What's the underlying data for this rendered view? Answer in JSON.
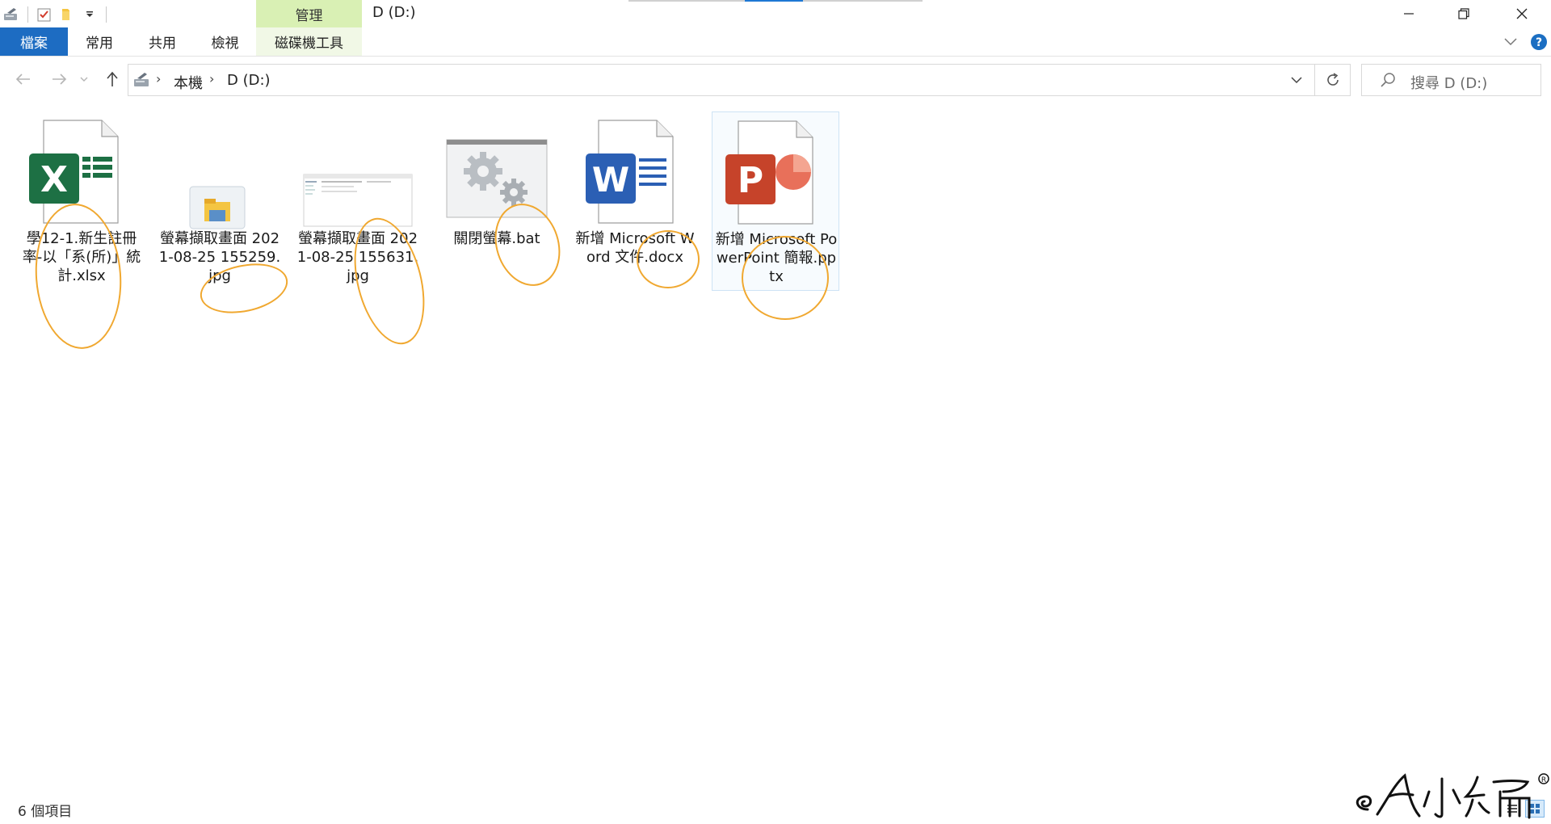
{
  "titlebar": {
    "title": "D (D:)",
    "context_tab_header": "管理"
  },
  "ribbon": {
    "tabs": [
      {
        "label": "檔案"
      },
      {
        "label": "常用"
      },
      {
        "label": "共用"
      },
      {
        "label": "檢視"
      },
      {
        "label": "磁碟機工具"
      }
    ]
  },
  "address": {
    "crumbs": [
      "本機",
      "D (D:)"
    ],
    "search_placeholder": "搜尋 D (D:)"
  },
  "files": [
    {
      "name": "學12-1.新生註冊率-以「系(所)」統計.xlsx",
      "type": "excel-icon"
    },
    {
      "name": "螢幕擷取畫面 2021-08-25 155259.jpg",
      "type": "image-file-icon"
    },
    {
      "name": "螢幕擷取畫面 2021-08-25 155631.jpg",
      "type": "screenshot-thumbnail"
    },
    {
      "name": "關閉螢幕.bat",
      "type": "batch-gears-icon"
    },
    {
      "name": "新增 Microsoft Word 文件.docx",
      "type": "word-icon"
    },
    {
      "name": "新增 Microsoft PowerPoint 簡報.pptx",
      "type": "powerpoint-icon",
      "selected": true
    }
  ],
  "status": {
    "count": "6 個項目"
  },
  "colors": {
    "file_tab": "#1d6cc2",
    "context_tab": "#d9f0b4",
    "annotation": "#f0a830",
    "excel": "#1d7044",
    "word": "#2b5fb4",
    "powerpoint": "#c6432a"
  }
}
